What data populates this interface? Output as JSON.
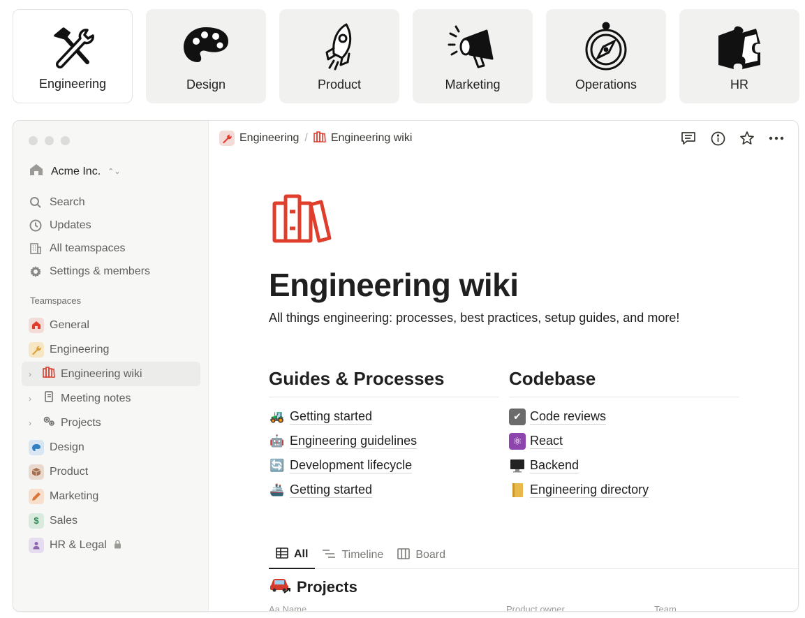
{
  "cards": [
    {
      "label": "Engineering",
      "icon": "tools-icon",
      "active": true
    },
    {
      "label": "Design",
      "icon": "palette-icon"
    },
    {
      "label": "Product",
      "icon": "rocket-icon"
    },
    {
      "label": "Marketing",
      "icon": "megaphone-icon"
    },
    {
      "label": "Operations",
      "icon": "compass-icon"
    },
    {
      "label": "HR",
      "icon": "puzzle-icon"
    }
  ],
  "sidebar": {
    "workspace": "Acme Inc.",
    "nav": [
      {
        "label": "Search",
        "icon": "search-icon"
      },
      {
        "label": "Updates",
        "icon": "clock-icon"
      },
      {
        "label": "All teamspaces",
        "icon": "building-icon"
      },
      {
        "label": "Settings & members",
        "icon": "gear-icon"
      }
    ],
    "teamspaces_heading": "Teamspaces",
    "teamspaces": [
      {
        "label": "General",
        "icon": "home-icon",
        "color": "#f3dcd8"
      },
      {
        "label": "Engineering",
        "icon": "wrench-icon",
        "color": "#f7e6c4"
      },
      {
        "label": "Engineering wiki",
        "icon": "books-icon",
        "sub": true,
        "selected": true
      },
      {
        "label": "Meeting notes",
        "icon": "notebook-icon",
        "sub": true
      },
      {
        "label": "Projects",
        "icon": "gears-icon",
        "sub": true
      },
      {
        "label": "Design",
        "icon": "palette-icon",
        "color": "#d8e5f3"
      },
      {
        "label": "Product",
        "icon": "box-icon",
        "color": "#ead9cd"
      },
      {
        "label": "Marketing",
        "icon": "pencil-icon",
        "color": "#f6dfcd"
      },
      {
        "label": "Sales",
        "icon": "dollar-icon",
        "color": "#d9eadf"
      },
      {
        "label": "HR & Legal",
        "icon": "person-icon",
        "color": "#e6dcef",
        "locked": true
      }
    ]
  },
  "breadcrumb": {
    "parent": "Engineering",
    "current": "Engineering wiki"
  },
  "page": {
    "title": "Engineering wiki",
    "description": "All things engineering: processes, best practices, setup guides, and more!"
  },
  "guides": {
    "title": "Guides & Processes",
    "items": [
      {
        "label": "Getting started",
        "emoji": "🚜"
      },
      {
        "label": "Engineering guidelines",
        "emoji": "🤖"
      },
      {
        "label": "Development lifecycle",
        "emoji": "🔄"
      },
      {
        "label": "Getting started",
        "emoji": "🚢"
      }
    ]
  },
  "codebase": {
    "title": "Codebase",
    "items": [
      {
        "label": "Code reviews",
        "emoji": "✅"
      },
      {
        "label": "React",
        "emoji": "⚛"
      },
      {
        "label": "Backend",
        "emoji": "🖥"
      },
      {
        "label": "Engineering directory",
        "emoji": "📒"
      }
    ]
  },
  "tabs": [
    {
      "label": "All",
      "icon": "table-icon",
      "active": true
    },
    {
      "label": "Timeline",
      "icon": "timeline-icon"
    },
    {
      "label": "Board",
      "icon": "board-icon"
    }
  ],
  "projects": {
    "title": "Projects",
    "columns": [
      "Aa Name",
      "Product owner",
      "Team"
    ]
  },
  "colors": {
    "accent_red": "#e03e2d",
    "sidebar_bg": "#f7f7f5",
    "card_bg": "#f1f1ef"
  }
}
